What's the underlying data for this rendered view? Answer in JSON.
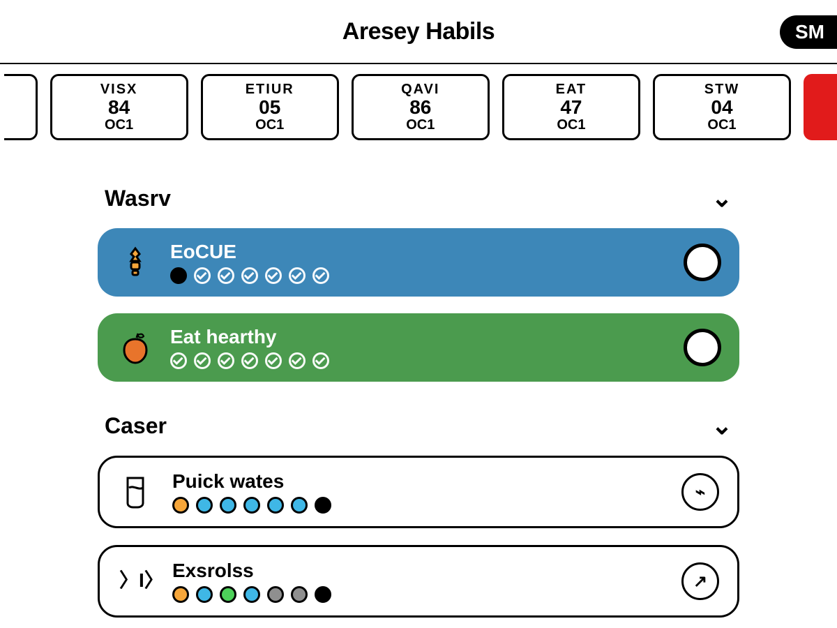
{
  "header": {
    "title": "Aresey Habils",
    "pill": "SM"
  },
  "dates": [
    {
      "dow": "VISX",
      "num": "84",
      "mon": "OC1"
    },
    {
      "dow": "ETIUR",
      "num": "05",
      "mon": "OC1"
    },
    {
      "dow": "QAVI",
      "num": "86",
      "mon": "OC1"
    },
    {
      "dow": "EAT",
      "num": "47",
      "mon": "OC1"
    },
    {
      "dow": "STW",
      "num": "04",
      "mon": "OC1"
    }
  ],
  "sections": [
    {
      "title": "Wasrv",
      "habits": [
        {
          "name": "EoCUE",
          "variant": "blue",
          "icon": "lightbulb",
          "dots": [
            "filled",
            "check",
            "check",
            "check",
            "check",
            "check",
            "check"
          ],
          "action_glyph": "◀"
        },
        {
          "name": "Eat hearthy",
          "variant": "green",
          "icon": "apple",
          "dots": [
            "check",
            "check",
            "check",
            "check",
            "check",
            "check",
            "check"
          ],
          "action_glyph": "▣"
        }
      ]
    },
    {
      "title": "Caser",
      "habits": [
        {
          "name": "Puick wates",
          "variant": "white",
          "icon": "cup",
          "wdots": [
            "orange",
            "cyan",
            "cyan",
            "cyan",
            "cyan",
            "cyan",
            "black"
          ],
          "action_glyph": "⌁"
        },
        {
          "name": "Exsrolss",
          "variant": "white",
          "icon": "exercise",
          "wdots": [
            "orange",
            "cyan",
            "green",
            "cyan",
            "grey",
            "grey",
            "black"
          ],
          "action_glyph": "↗"
        }
      ]
    }
  ]
}
